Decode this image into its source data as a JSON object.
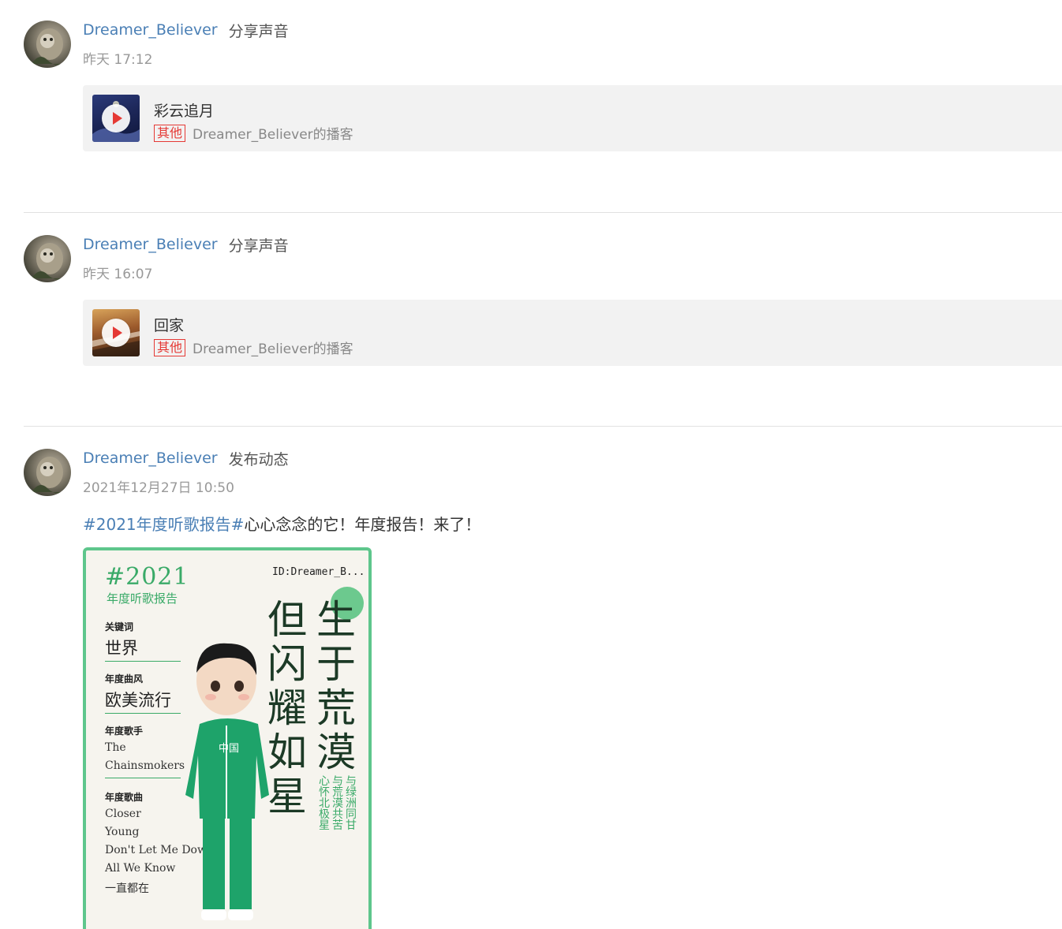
{
  "posts": [
    {
      "username": "Dreamer_Believer",
      "action": "分享声音",
      "time": "昨天 17:12",
      "card": {
        "title": "彩云追月",
        "tag": "其他",
        "podcast": "Dreamer_Believer的播客"
      }
    },
    {
      "username": "Dreamer_Believer",
      "action": "分享声音",
      "time": "昨天 16:07",
      "card": {
        "title": "回家",
        "tag": "其他",
        "podcast": "Dreamer_Believer的播客"
      }
    },
    {
      "username": "Dreamer_Believer",
      "action": "发布动态",
      "time": "2021年12月27日 10:50",
      "hashtag": "#2021年度听歌报告#",
      "text": "心心念念的它！年度报告！来了！",
      "report": {
        "year": "#2021",
        "subtitle": "年度听歌报告",
        "id": "ID:Dreamer_B...",
        "keyword_label": "关键词",
        "keyword": "世界",
        "genre_label": "年度曲风",
        "genre": "欧美流行",
        "artist_label": "年度歌手",
        "artist_line1": "The",
        "artist_line2": "Chainsmokers",
        "songs_label": "年度歌曲",
        "songs": [
          "Closer",
          "Young",
          "Don't Let Me Dow",
          "All We Know",
          "一直都在"
        ],
        "slogan_col1": "生于荒漠",
        "slogan_col2": "但闪耀如星",
        "small_col1": "与绿洲同甘",
        "small_col2": "与荒漠共苦",
        "small_col3": "心怀北极星",
        "jacket_text": "中国"
      }
    }
  ],
  "colors": {
    "link": "#4a7fb5",
    "tag": "#e53935",
    "report_green": "#5ec68c"
  }
}
